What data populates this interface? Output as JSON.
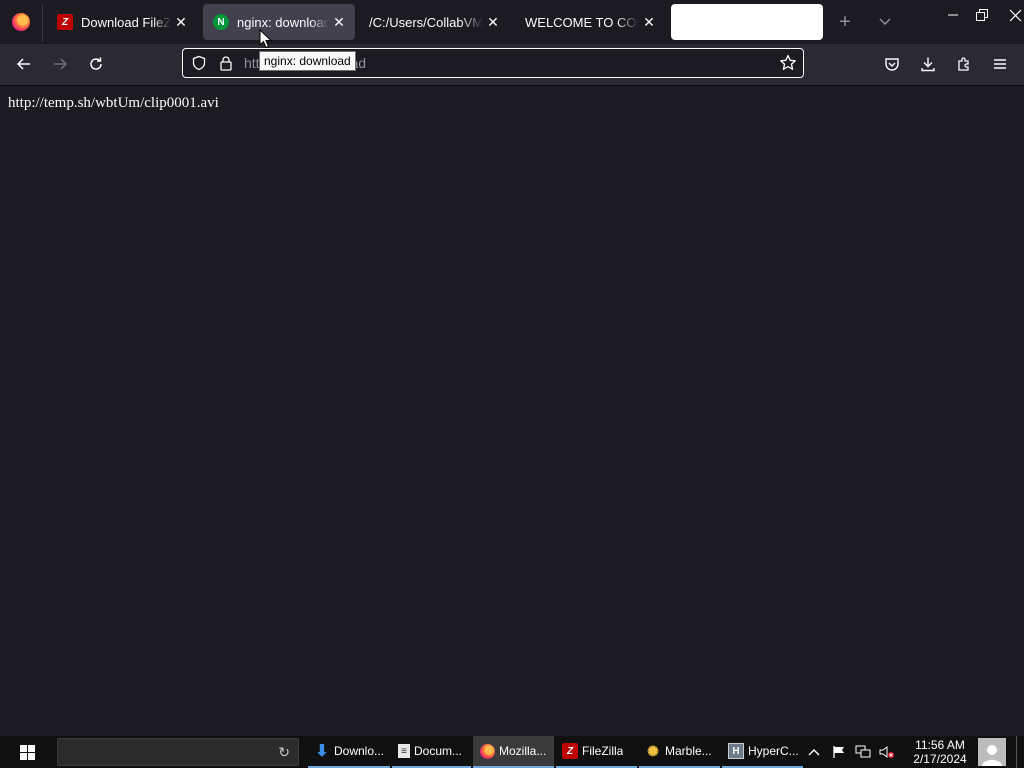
{
  "tabs": [
    {
      "title": "Download FileZilla Client",
      "favicon": "filezilla-icon",
      "active": false
    },
    {
      "title": "nginx: download",
      "favicon": "nginx-icon",
      "active": true
    },
    {
      "title": "/C:/Users/CollabVM/Desktop",
      "favicon": "",
      "active": false
    },
    {
      "title": "WELCOME TO COLLABVM",
      "favicon": "",
      "active": false
    }
  ],
  "tooltip": "nginx: download",
  "address": {
    "url_left": "htt",
    "url_right": "load"
  },
  "content": {
    "text": "http://temp.sh/wbtUm/clip0001.avi"
  },
  "taskbar": {
    "items": [
      {
        "label": "Downlo...",
        "icon": "download-arrow-icon",
        "active": false
      },
      {
        "label": "Docum...",
        "icon": "document-icon",
        "active": false
      },
      {
        "label": "Mozilla...",
        "icon": "firefox-icon",
        "active": true
      },
      {
        "label": "FileZilla",
        "icon": "filezilla-icon",
        "active": false
      },
      {
        "label": "Marble...",
        "icon": "marble-icon",
        "active": false
      },
      {
        "label": "HyperC...",
        "icon": "hypercam-icon",
        "active": false
      }
    ],
    "clock_time": "11:56 AM",
    "clock_date": "2/17/2024"
  },
  "colors": {
    "tab_active": "#42414d",
    "toolbar": "#2b2a33",
    "page_bg": "#1c1b22",
    "taskbar": "#101010",
    "taskbar_underline": "#6fa8dc"
  }
}
